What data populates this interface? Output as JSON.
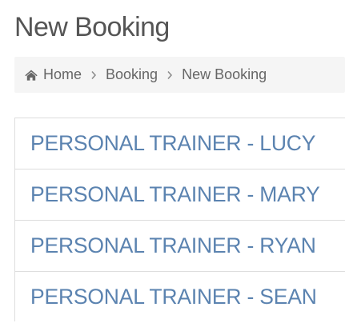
{
  "page": {
    "title": "New Booking"
  },
  "breadcrumb": {
    "home_icon": "home-icon",
    "separator_icon": "chevron-right-icon",
    "items": [
      {
        "label": "Home"
      },
      {
        "label": "Booking"
      },
      {
        "label": "New Booking"
      }
    ]
  },
  "trainers": [
    {
      "label": "PERSONAL TRAINER - LUCY"
    },
    {
      "label": "PERSONAL TRAINER - MARY"
    },
    {
      "label": "PERSONAL TRAINER - RYAN"
    },
    {
      "label": "PERSONAL TRAINER - SEAN"
    }
  ],
  "colors": {
    "link": "#5b83b0",
    "text": "#555555",
    "breadcrumb_bg": "#f5f5f5",
    "border": "#dddddd"
  }
}
